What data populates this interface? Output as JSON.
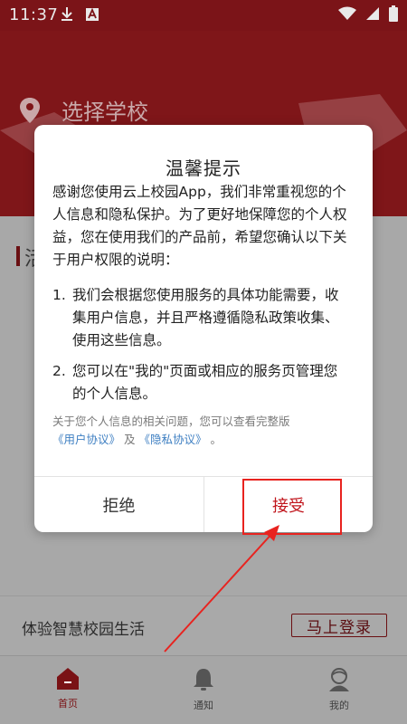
{
  "status_bar": {
    "time": "11:37",
    "icons": [
      "download-icon",
      "app-notification-icon",
      "wifi-icon",
      "signal-icon",
      "battery-icon"
    ]
  },
  "header": {
    "select_school": "选择学校",
    "location_icon": "location-pin-icon"
  },
  "section": {
    "title_glyph": "活"
  },
  "dialog": {
    "title": "温馨提示",
    "intro": "感谢您使用云上校园App，我们非常重视您的个人信息和隐私保护。为了更好地保障您的个人权益，您在使用我们的产品前，希望您确认以下关于用户权限的说明：",
    "items": [
      {
        "num": "1.",
        "text": "我们会根据您使用服务的具体功能需要，收集用户信息，并且严格遵循隐私政策收集、使用这些信息。"
      },
      {
        "num": "2.",
        "text": "您可以在\"我的\"页面或相应的服务页管理您的个人信息。"
      }
    ],
    "note_prefix": "关于您个人信息的相关问题，您可以查看完整版",
    "user_agreement": "《用户协议》",
    "and": " 及 ",
    "privacy_policy": "《隐私协议》",
    "note_suffix": " 。",
    "reject": "拒绝",
    "accept": "接受"
  },
  "experience": {
    "text": "体验智慧校园生活",
    "login": "马上登录"
  },
  "bottom_nav": [
    {
      "label": "首页",
      "icon": "home-icon",
      "active": true
    },
    {
      "label": "通知",
      "icon": "bell-icon",
      "active": false
    },
    {
      "label": "我的",
      "icon": "profile-icon",
      "active": false
    }
  ],
  "colors": {
    "brand_red": "#7f1619",
    "accept_red": "#c0141b",
    "link_blue": "#3e7fc2",
    "annotation_red": "#e8231f"
  }
}
